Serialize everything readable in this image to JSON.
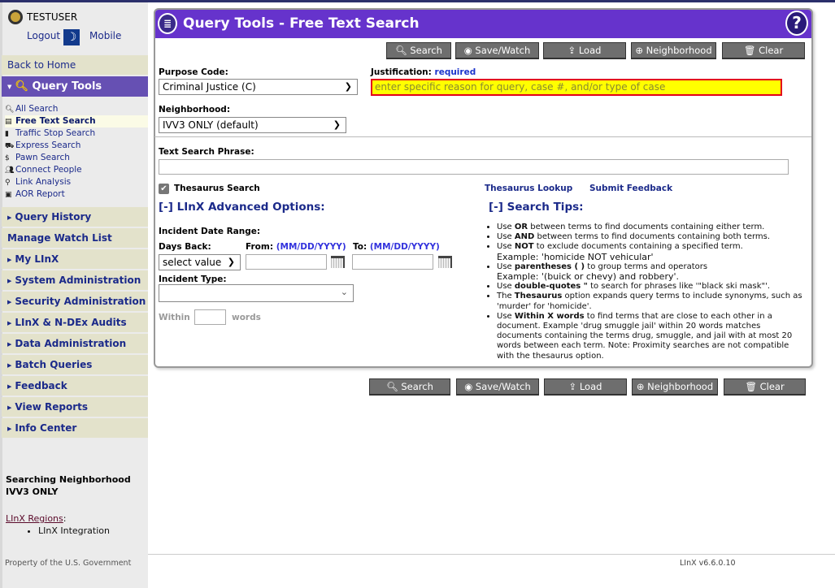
{
  "user": {
    "name": "TESTUSER",
    "logout": "Logout",
    "mobile": "Mobile"
  },
  "sidebar": {
    "back_home": "Back to Home",
    "query_tools": "Query Tools",
    "sub_items": [
      {
        "label": "All Search",
        "icon": "all-search-icon"
      },
      {
        "label": "Free Text Search",
        "icon": "document-icon"
      },
      {
        "label": "Traffic Stop Search",
        "icon": "traffic-light-icon"
      },
      {
        "label": "Express Search",
        "icon": "car-icon"
      },
      {
        "label": "Pawn Search",
        "icon": "pawn-icon"
      },
      {
        "label": "Connect People",
        "icon": "people-icon"
      },
      {
        "label": "Link Analysis",
        "icon": "network-icon"
      },
      {
        "label": "AOR Report",
        "icon": "map-icon"
      }
    ],
    "items": [
      "Query History",
      "Manage Watch List",
      "My LInX",
      "System Administration",
      "Security Administration",
      "LInX & N-DEx Audits",
      "Data Administration",
      "Batch Queries",
      "Feedback",
      "View Reports",
      "Info Center"
    ],
    "neighborhood_title": "Searching Neighborhood",
    "neighborhood_value": "IVV3 ONLY",
    "regions_label": "LInX Regions",
    "regions": [
      "LInX Integration"
    ]
  },
  "panel": {
    "title": "Query Tools - Free Text Search",
    "buttons": [
      "Search",
      "Save/Watch",
      "Load",
      "Neighborhood",
      "Clear"
    ],
    "purpose_label": "Purpose Code:",
    "purpose_value": "Criminal Justice (C)",
    "justification_label": "Justification:",
    "justification_required": "required",
    "justification_placeholder": "enter specific reason for query, case #, and/or type of case",
    "neighborhood_label": "Neighborhood:",
    "neighborhood_value": "IVV3 ONLY (default)",
    "text_phrase_label": "Text Search Phrase:",
    "text_phrase_value": "",
    "thesaurus_label": "Thesaurus Search",
    "thesaurus_checked": true,
    "thesaurus_lookup": "Thesaurus Lookup",
    "submit_feedback": "Submit Feedback",
    "advanced_title": "[-] LInX Advanced Options:",
    "date_range_label": "Incident Date Range:",
    "days_back_label": "Days Back:",
    "days_back_value": "select value",
    "from_label": "From:",
    "to_label": "To:",
    "date_format": "(MM/DD/YYYY)",
    "incident_type_label": "Incident Type:",
    "within_label": "Within",
    "words_label": "words",
    "tips_title": "[-] Search Tips:",
    "tips": [
      {
        "pre": "Use ",
        "b": "OR",
        "post": " between terms to find documents containing either term."
      },
      {
        "pre": "Use ",
        "b": "AND",
        "post": " between terms to find documents containing both terms."
      },
      {
        "pre": "Use ",
        "b": "NOT",
        "post": " to exclude documents containing a specified term.",
        "ex": "Example: 'homicide NOT vehicular'"
      },
      {
        "pre": "Use ",
        "b": "parentheses ( )",
        "post": " to group terms and operators",
        "ex": "Example: '(buick or chevy) and robbery'."
      },
      {
        "pre": "Use ",
        "b": "double-quotes \"",
        "post": " to search for phrases like '\"black ski mask\"'."
      },
      {
        "pre": "The ",
        "b": "Thesaurus",
        "post": " option expands query terms to include synonyms, such as 'murder' for 'homicide'."
      },
      {
        "pre": "Use ",
        "b": "Within X words",
        "post": " to find terms that are close to each other in a document. Example 'drug smuggle jail' within 20 words matches documents containing the terms drug, smuggle, and jail with at most 20 words between each term. Note: Proximity searches are not compatible with the thesaurus option."
      }
    ]
  },
  "footer": {
    "property": "Property of the U.S. Government",
    "version": "LInX v6.6.0.10"
  }
}
